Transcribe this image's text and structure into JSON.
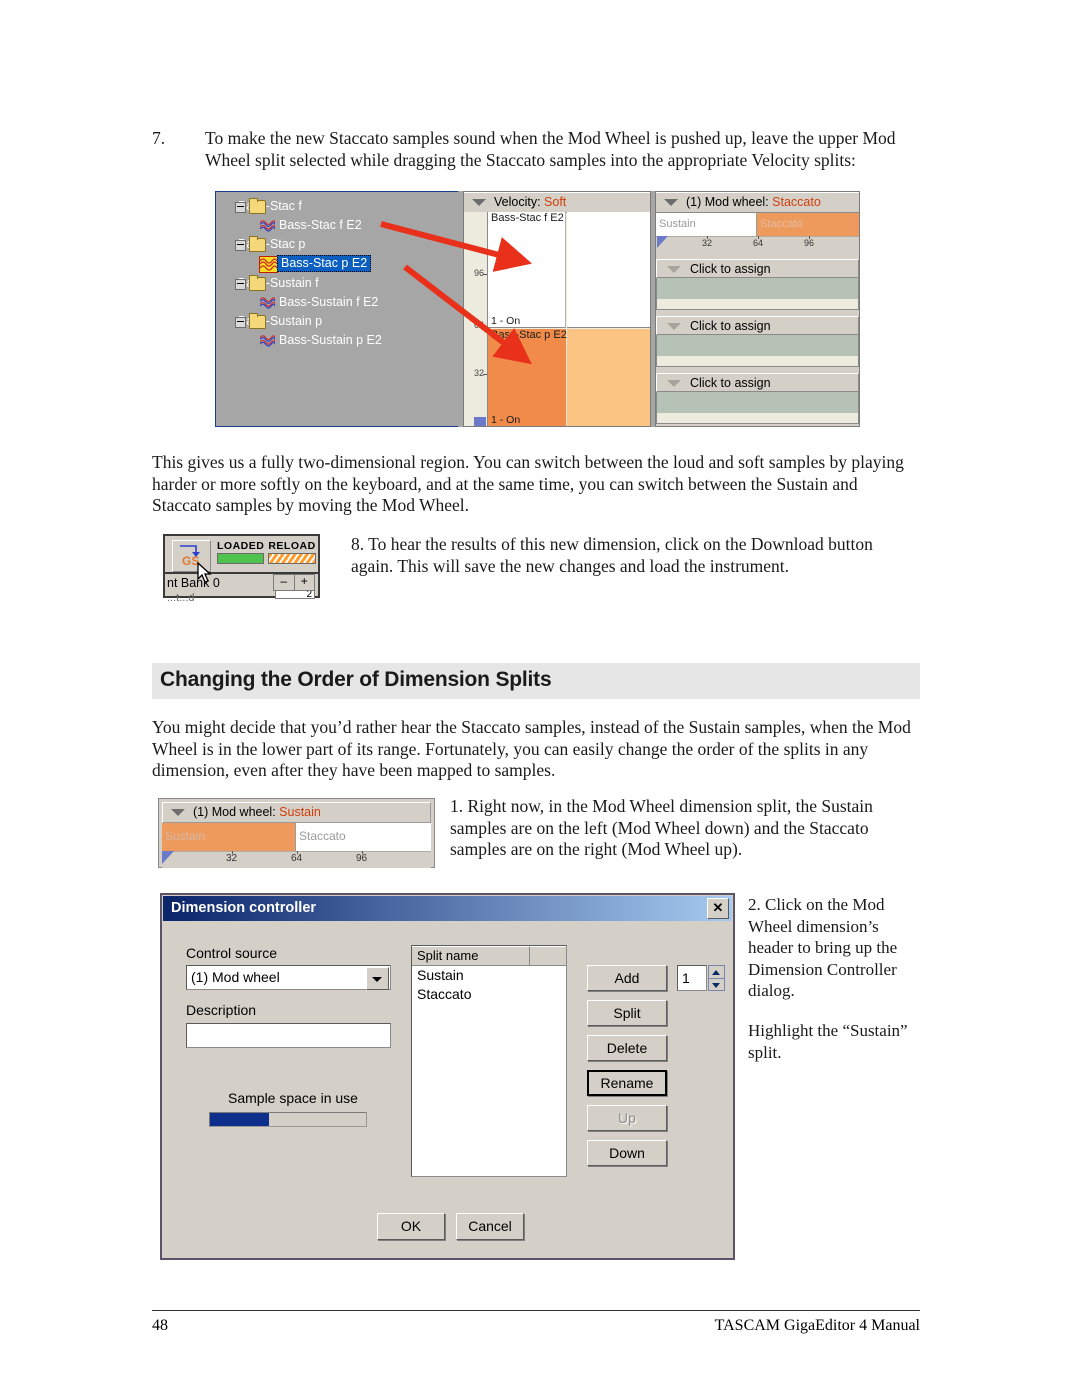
{
  "page": {
    "number": "48",
    "footer_title": "TASCAM GigaEditor 4 Manual"
  },
  "steps": {
    "step7_number": "7.",
    "step7_text": "To make the new Staccato samples sound when the Mod Wheel is pushed up, leave the upper Mod Wheel split selected while dragging the Staccato samples into the appropriate Velocity splits:",
    "step8_text": "8. To hear the results of this new dimension, click on the Download button again. This will save the new changes and load the instrument.",
    "step1_text": "1. Right now, in the Mod Wheel dimension split, the Sustain samples are on the left (Mod Wheel down) and the Staccato samples are on the right (Mod Wheel up).",
    "step2_text": "2. Click on the Mod Wheel dimension’s header to bring up the Dimension Controller dialog.",
    "step2_text2": "Highlight the “Sustain” split."
  },
  "paragraphs": {
    "para1": "This gives us a fully two-dimensional region.  You can switch between the loud and soft samples by playing harder or more softly on the keyboard, and at the same time, you can switch between the Sustain and Staccato samples by moving the Mod Wheel.",
    "para2": "You might decide that you’d rather hear the Staccato samples, instead of the Sustain samples, when the Mod Wheel is in the lower part of its range.  Fortunately, you can easily change the order of the splits in any dimension, even after they have been mapped to samples."
  },
  "heading": {
    "title": "Changing the Order of Dimension Splits"
  },
  "figure1": {
    "tree": [
      {
        "label": "Bass-Stac f",
        "type": "folder"
      },
      {
        "label": "Bass-Stac f E2",
        "type": "sample"
      },
      {
        "label": "Bass-Stac p",
        "type": "folder"
      },
      {
        "label": "Bass-Stac p E2",
        "type": "sample-selected"
      },
      {
        "label": "Bass-Sustain f",
        "type": "folder"
      },
      {
        "label": "Bass-Sustain f E2",
        "type": "sample"
      },
      {
        "label": "Bass-Sustain p",
        "type": "folder"
      },
      {
        "label": "Bass-Sustain p E2",
        "type": "sample"
      }
    ],
    "velocity": {
      "header_label": "Velocity:",
      "header_value": "Soft",
      "upper_cell_label": "Bass-Stac f E2 *",
      "upper_cell_on": "1 - On",
      "lower_cell_label": "Bass-Stac p E2 *",
      "lower_cell_on": "1 - On",
      "ticks": [
        "96",
        "64",
        "32"
      ]
    },
    "modwheel": {
      "header_label": "(1) Mod wheel:",
      "header_value": "Staccato",
      "seg_left": "Sustain",
      "seg_right": "Staccato",
      "scale": [
        "32",
        "64",
        "96"
      ],
      "assign_rows": [
        "Click to assign",
        "Click to assign",
        "Click to assign"
      ]
    }
  },
  "figure2": {
    "gs_label": "GS",
    "loaded_label": "LOADED",
    "reload_label": "RELOAD",
    "lower_text": "nt Bank 0",
    "lower_text2": "...t...d",
    "minus": "–",
    "plus": "+",
    "value": "2"
  },
  "figure3": {
    "header_label": "(1) Mod wheel:",
    "header_value": "Sustain",
    "seg_left": "Sustain",
    "seg_right": "Staccato",
    "scale": [
      "32",
      "64",
      "96"
    ]
  },
  "dialog": {
    "title": "Dimension controller",
    "close_label": "✕",
    "control_source_label": "Control source",
    "control_source_value": "(1) Mod wheel",
    "description_label": "Description",
    "description_value": "",
    "sample_space_label": "Sample space in use",
    "sample_space_percent": 38,
    "split_name_header": "Split name",
    "splits": [
      "Sustain",
      "Staccato"
    ],
    "selected_split": "Sustain",
    "buttons": {
      "add": "Add",
      "split": "Split",
      "delete": "Delete",
      "rename": "Rename",
      "up": "Up",
      "down": "Down",
      "ok": "OK",
      "cancel": "Cancel"
    },
    "count_value": "1"
  },
  "colors": {
    "accent_orange": "#ef9a5d",
    "header_red": "#d03d0b",
    "arrow_red": "#e8301a",
    "selection_blue": "#0a5fc0",
    "progress_blue": "#0f2f8c",
    "heading_band": "#e6e6e6"
  }
}
